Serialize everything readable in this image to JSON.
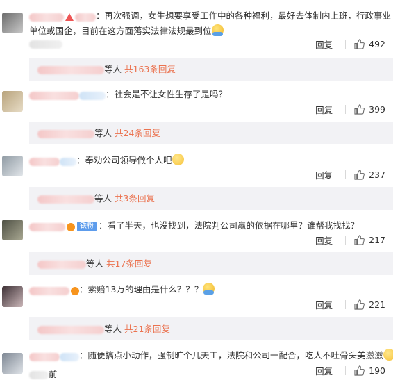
{
  "comments": [
    {
      "text": "：再次强调，女生想要享受工作中的各种福利，最好去体制内上班，行政事业单位或国企，目前在这方面落实法律法规最到位",
      "reply_label": "回复",
      "likes": "492",
      "sub_prefix": "等人",
      "sub_link": "共163条回复"
    },
    {
      "text": "：社会是不让女性生存了是吗？",
      "reply_label": "回复",
      "likes": "399",
      "sub_prefix": "等人",
      "sub_link": "共24条回复"
    },
    {
      "text": "：奉劝公司领导做个人吧",
      "reply_label": "回复",
      "likes": "237",
      "sub_prefix": "等人",
      "sub_link": "共3条回复"
    },
    {
      "badge": "铁粉",
      "text": "：看了半天，也没找到，法院判公司赢的依据在哪里？谁帮我找找？",
      "reply_label": "回复",
      "likes": "217",
      "sub_prefix": "等人",
      "sub_link": "共17条回复"
    },
    {
      "text": "：索赔13万的理由是什么？？？",
      "reply_label": "回复",
      "likes": "221",
      "sub_prefix": "等人",
      "sub_link": "共21条回复"
    },
    {
      "text": "：随便搞点小动作，强制旷个几天工，法院和公司一配合，吃人不吐骨头美滋滋",
      "time_suffix": "前",
      "reply_label": "回复",
      "likes": "190"
    }
  ],
  "colors": {
    "link": "#eb7350",
    "badge": "#5d9cec",
    "sub_bg": "#f2f2f5"
  },
  "icons": [
    "thumbs-up-icon",
    "hug-emoji",
    "smile-emoji",
    "fan-badge"
  ]
}
